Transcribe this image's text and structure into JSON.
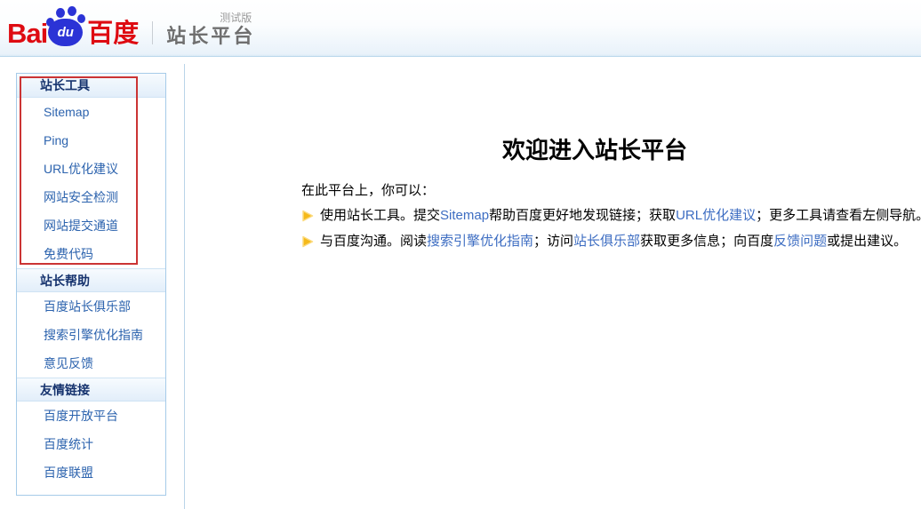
{
  "header": {
    "logo": {
      "bai": "Bai",
      "du": "du",
      "cn": "百度"
    },
    "product_title": "站长平台",
    "badge": "测试版"
  },
  "sidebar": {
    "sections": [
      {
        "title": "站长工具",
        "highlighted": true,
        "items": [
          "Sitemap",
          "Ping",
          "URL优化建议",
          "网站安全检测",
          "网站提交通道",
          "免费代码"
        ]
      },
      {
        "title": "站长帮助",
        "highlighted": false,
        "items": [
          "百度站长俱乐部",
          "搜索引擎优化指南",
          "意见反馈"
        ]
      },
      {
        "title": "友情链接",
        "highlighted": false,
        "items": [
          "百度开放平台",
          "百度统计",
          "百度联盟"
        ]
      }
    ]
  },
  "main": {
    "title": "欢迎进入站长平台",
    "intro": "在此平台上，你可以：",
    "bullets": [
      {
        "segments": [
          {
            "t": "使用站长工具。提交",
            "link": false
          },
          {
            "t": "Sitemap",
            "link": true
          },
          {
            "t": "帮助百度更好地发现链接；获取",
            "link": false
          },
          {
            "t": "URL优化建议",
            "link": true
          },
          {
            "t": "；更多工具请查看左侧导航。",
            "link": false
          }
        ]
      },
      {
        "segments": [
          {
            "t": "与百度沟通。阅读",
            "link": false
          },
          {
            "t": "搜索引擎优化指南",
            "link": true
          },
          {
            "t": "；访问",
            "link": false
          },
          {
            "t": "站长俱乐部",
            "link": true
          },
          {
            "t": "获取更多信息；向百度",
            "link": false
          },
          {
            "t": "反馈问题",
            "link": true
          },
          {
            "t": "或提出建议。",
            "link": false
          }
        ]
      }
    ]
  },
  "colors": {
    "brand_red": "#de0b12",
    "paw_blue": "#2b33d6",
    "sidebar_link_blue": "#2c63ae",
    "content_link_blue": "#3d6dc2",
    "highlight_border_red": "#cb3434",
    "arrow_gold": "#f5b919",
    "section_title_navy": "#16336e"
  }
}
